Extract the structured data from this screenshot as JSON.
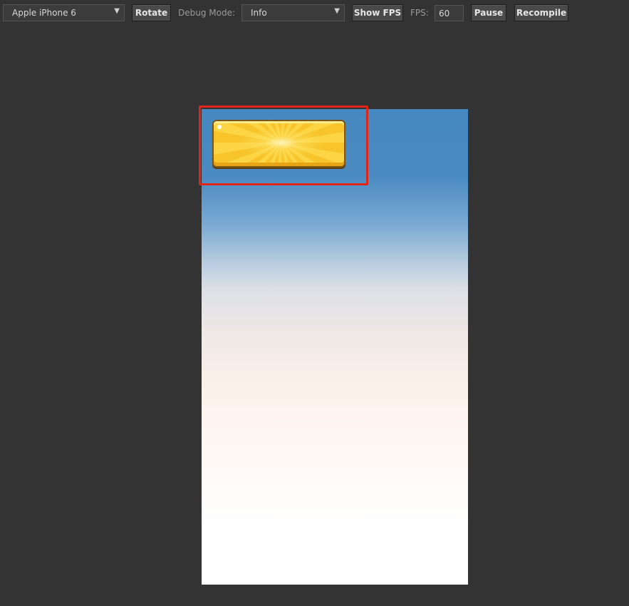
{
  "toolbar": {
    "device_select": {
      "value": "Apple iPhone 6"
    },
    "rotate_label": "Rotate",
    "debug_mode_label": "Debug Mode:",
    "debug_select": {
      "value": "Info"
    },
    "show_fps_label": "Show FPS",
    "fps_label": "FPS:",
    "fps_value": "60",
    "pause_label": "Pause",
    "recompile_label": "Recompile"
  },
  "colors": {
    "page_background": "#333333",
    "highlight_border": "#e1251b",
    "button_yellow": "#f8c830",
    "sky_top": "#4587c0"
  },
  "icons": {
    "dropdown": "caret-down-icon"
  }
}
